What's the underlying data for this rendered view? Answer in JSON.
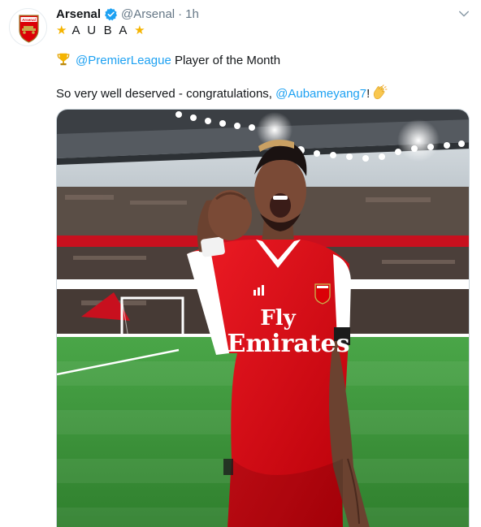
{
  "tweet": {
    "display_name": "Arsenal",
    "handle": "@Arsenal",
    "separator": "·",
    "time": "1h",
    "line1": "A U B A",
    "line2_mention": "@PremierLeague",
    "line2_text": " Player of the Month",
    "line3_text": "So very well deserved - congratulations, ",
    "line3_mention": "@Aubameyang7",
    "line3_suffix": "!",
    "shirt_sponsor_line1": "Fly",
    "shirt_sponsor_line2": "Emirates",
    "avatar_label": "Arsenal"
  },
  "icons": {
    "verified": "verified-badge-icon",
    "caret": "chevron-down-icon",
    "star": "star-emoji",
    "trophy": "trophy-emoji",
    "clap": "clapping-hands-emoji"
  },
  "colors": {
    "link": "#1da1f2",
    "muted": "#657786",
    "text": "#14171a",
    "arsenal_red": "#db0007",
    "pitch_green": "#3d9a3a"
  }
}
